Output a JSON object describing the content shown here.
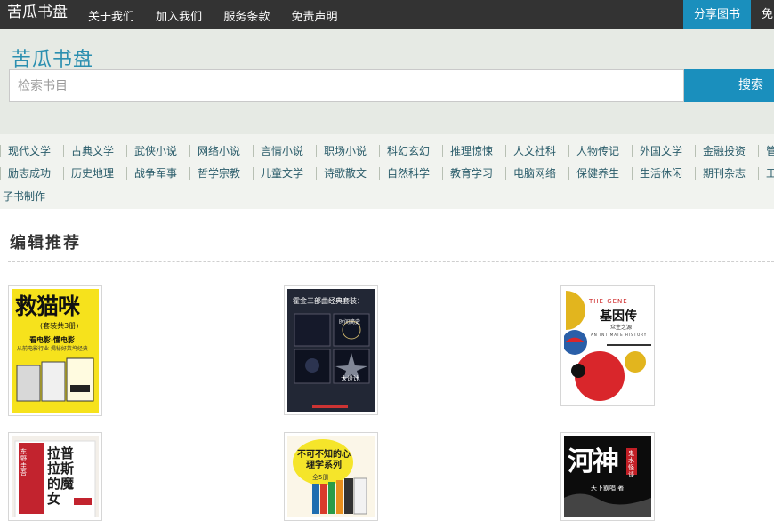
{
  "topbar": {
    "brand": "苦瓜书盘",
    "nav": [
      "关于我们",
      "加入我们",
      "服务条款",
      "免责声明"
    ],
    "share_button": "分享图书",
    "extra_link": "免"
  },
  "hero": {
    "site_title": "苦瓜书盘",
    "search_placeholder": "检索书目",
    "search_button": "搜索"
  },
  "categories": {
    "row1": [
      "现代文学",
      "古典文学",
      "武侠小说",
      "网络小说",
      "言情小说",
      "职场小说",
      "科幻玄幻",
      "推理惊悚",
      "人文社科",
      "人物传记",
      "外国文学",
      "金融投资",
      "管"
    ],
    "row2": [
      "励志成功",
      "历史地理",
      "战争军事",
      "哲学宗教",
      "儿童文学",
      "诗歌散文",
      "自然科学",
      "教育学习",
      "电脑网络",
      "保健养生",
      "生活休闲",
      "期刊杂志",
      "工"
    ],
    "row3_tail": "子书制作"
  },
  "section": {
    "title": "编辑推荐"
  },
  "books": [
    {
      "cover_title": "救猫咪",
      "cover_sub": "(套装共3册)",
      "cover_tag": "看电影·懂电影",
      "cover_line": "从前电影行业 揭秘好莱坞经典"
    },
    {
      "cover_title": "霍金三部曲经典套装：",
      "cover_sub": "时间简史",
      "cover_line": "大设计"
    },
    {
      "cover_en": "THE GENE",
      "cover_title": "基因传",
      "cover_sub": "众生之源",
      "cover_en_sub": "AN INTIMATE HISTORY"
    },
    {
      "cover_title": "拉普拉斯的魔女",
      "cover_sub": "东野圭吾"
    },
    {
      "cover_title": "不可不知的心理学系列",
      "cover_sub": "全5册"
    },
    {
      "cover_title": "河神",
      "cover_sub": "鬼水怪谈",
      "cover_line": "天下霸唱 著"
    }
  ],
  "colors": {
    "topbar_bg": "#333333",
    "accent_blue": "#1a8fbd",
    "title_teal": "#2b8fb0",
    "hero_bg": "#e6eae4"
  }
}
